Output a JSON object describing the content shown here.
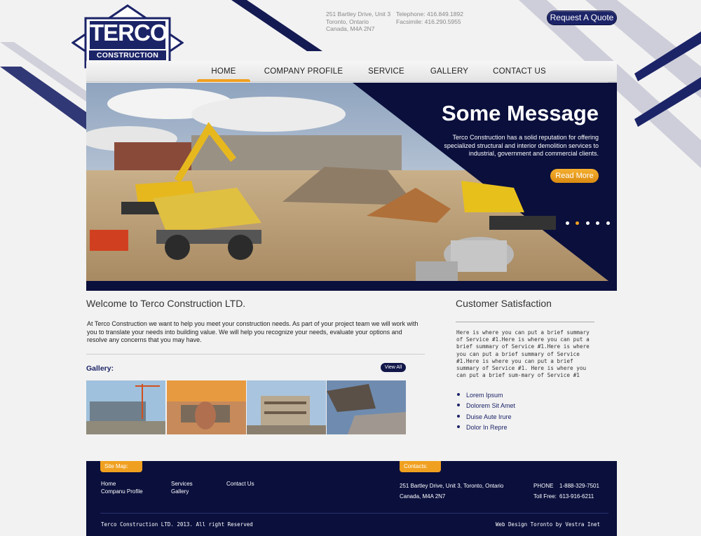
{
  "logo": {
    "name": "TERCO",
    "subtitle": "CONSTRUCTION LTD"
  },
  "header": {
    "address": [
      "251 Bartley Drive, Unit 3",
      "Toronto, Ontario",
      "Canada, M4A 2N7"
    ],
    "phones": [
      "Telephone: 416.849.1892",
      "Facsimile: 416.290.5955"
    ],
    "quote_button": "Request A Quote"
  },
  "nav": {
    "items": [
      {
        "label": "HOME",
        "active": true
      },
      {
        "label": "COMPANY PROFILE",
        "active": false
      },
      {
        "label": "SERVICE",
        "active": false
      },
      {
        "label": "GALLERY",
        "active": false
      },
      {
        "label": "CONTACT US",
        "active": false
      }
    ]
  },
  "hero": {
    "title": "Some Message",
    "text": "Terco Construction has a solid reputation for offering specialized structural and interior demolition services to industrial, government and commercial clients.",
    "button": "Read More",
    "slides": 5,
    "active_slide": 2
  },
  "welcome": {
    "title": "Welcome to Terco Construction LTD.",
    "text": "At Terco Construction we want to help you meet your construction needs. As part of your project team we will work with you to translate your needs into building value. We will help you recognize your needs, evaluate your options and resolve any concerns that you may have."
  },
  "gallery": {
    "label": "Gallery:",
    "view_all": "View All"
  },
  "satisfaction": {
    "title": "Customer Satisfaction",
    "text": "Here is where you can put a brief summary of Service #1.Here is where you can put a brief summary of Service #1.Here is where you can put a brief summary of Service #1.Here is where you can put a brief summary of Service #1. Here is where you can put a brief sum-mary of Service #1",
    "list": [
      "Lorem Ipsum",
      "Dolorem Sit Amet",
      "Duise Aute Irure",
      "Dolor In Repre"
    ]
  },
  "footer": {
    "sitemap_label": "Site Map:",
    "contacts_label": "Contacts:",
    "links": {
      "home": "Home",
      "company": "Companu Profile",
      "services": "Services",
      "gallery": "Gallery",
      "contact": "Contact Us"
    },
    "address_line1": "251 Bartley Drive, Unit 3, Toronto, Ontario",
    "address_line2": "Canada, M4A 2N7",
    "phone_label": "PHONE",
    "phone": "1-888-329-7501",
    "tollfree_label": "Toll Free:",
    "tollfree": "613-916-6211",
    "copyright": "Terco Construction LTD. 2013. All right Reserved",
    "credit": "Web Design Toronto by Vestra Inet"
  },
  "colors": {
    "navy": "#0a0f3c",
    "brand": "#1c2468",
    "accent": "#f0a020"
  }
}
